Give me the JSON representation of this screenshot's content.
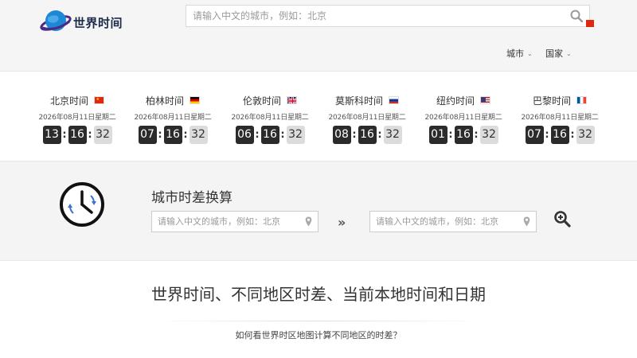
{
  "header": {
    "logo_text": "世界时间",
    "search_placeholder": "请输入中文的城市，例如：北京",
    "nav": [
      {
        "label": "城市"
      },
      {
        "label": "国家"
      }
    ]
  },
  "clocks": [
    {
      "city": "北京时间",
      "flag": "cn",
      "date": "2026年08月11日星期二",
      "hh": "13",
      "mm": "16",
      "ss": "32"
    },
    {
      "city": "柏林时间",
      "flag": "de",
      "date": "2026年08月11日星期二",
      "hh": "07",
      "mm": "16",
      "ss": "32"
    },
    {
      "city": "伦敦时间",
      "flag": "gb",
      "date": "2026年08月11日星期二",
      "hh": "06",
      "mm": "16",
      "ss": "32"
    },
    {
      "city": "莫斯科时间",
      "flag": "ru",
      "date": "2026年08月11日星期二",
      "hh": "08",
      "mm": "16",
      "ss": "32"
    },
    {
      "city": "纽约时间",
      "flag": "us",
      "date": "2026年08月11日星期二",
      "hh": "01",
      "mm": "16",
      "ss": "32"
    },
    {
      "city": "巴黎时间",
      "flag": "fr",
      "date": "2026年08月11日星期二",
      "hh": "07",
      "mm": "16",
      "ss": "32"
    }
  ],
  "converter": {
    "title": "城市时差换算",
    "from_placeholder": "请输入中文的城市，例如：北京",
    "to_placeholder": "请输入中文的城市，例如：北京",
    "arrow": "»"
  },
  "content": {
    "heading": "世界时间、不同地区时差、当前本地时间和日期",
    "link": "如何看世界时区地图计算不同地区的时差？"
  },
  "colors": {
    "header_bg": "#f5f5f5",
    "digit_bg": "#2b2b2b",
    "seconds_bg": "#dcdcdc",
    "converter_bg": "#f4f4f4"
  }
}
